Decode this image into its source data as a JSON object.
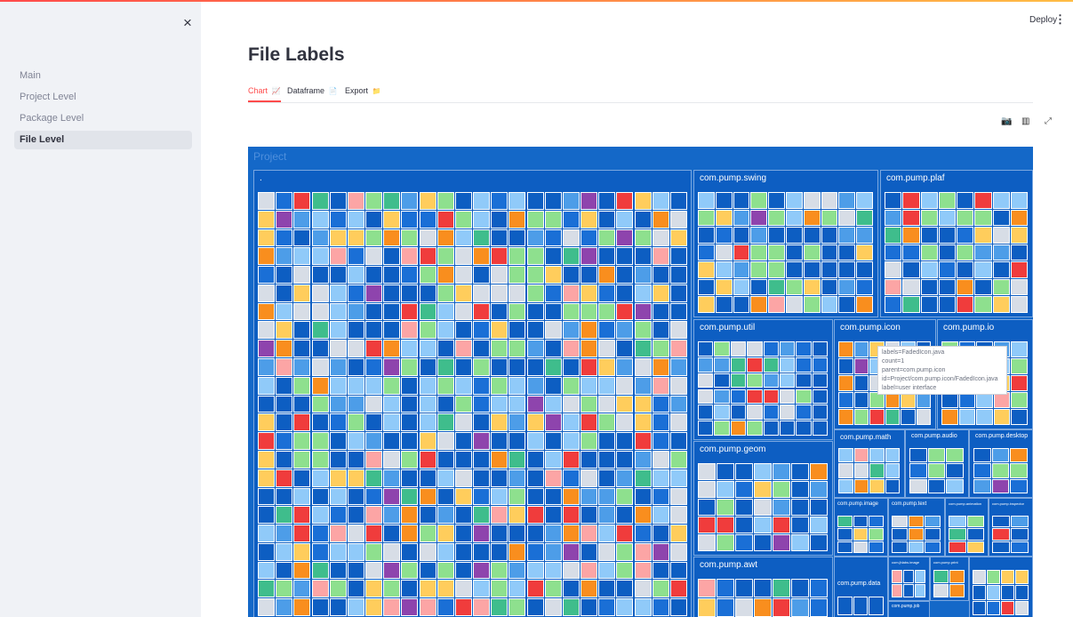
{
  "sidebar": {
    "close_label": "×",
    "items": [
      {
        "label": "Main",
        "active": false
      },
      {
        "label": "Project Level",
        "active": false
      },
      {
        "label": "Package Level",
        "active": false
      },
      {
        "label": "File Level",
        "active": true
      }
    ]
  },
  "header": {
    "deploy_label": "Deploy",
    "menu_label": "⋮"
  },
  "page": {
    "title": "File Labels"
  },
  "tabs": [
    {
      "label": "Chart",
      "icon": "chart-icon",
      "glyph": "📈",
      "active": true
    },
    {
      "label": "Dataframe",
      "icon": "document-icon",
      "glyph": "📄",
      "active": false
    },
    {
      "label": "Export",
      "icon": "folder-icon",
      "glyph": "📁",
      "active": false
    }
  ],
  "toolbar": {
    "camera_glyph": "📷",
    "plotly_glyph": "▥",
    "expand_glyph": "⤢"
  },
  "colors": {
    "accent": "#ff4b4b",
    "treemap_bg": "#1468c8",
    "palette": [
      "#0d5ec2",
      "#1a6fd6",
      "#90caf9",
      "#4d9de8",
      "#d7dde6",
      "#8ee08e",
      "#3fbd8c",
      "#ffcd5c",
      "#f98e1e",
      "#fca5a5",
      "#f03c3c",
      "#8e44ad"
    ]
  },
  "chart_data": {
    "type": "treemap",
    "root": "Project",
    "packages": [
      {
        "name": "."
      },
      {
        "name": "com.pump.swing"
      },
      {
        "name": "com.pump.plaf"
      },
      {
        "name": "com.pump.util"
      },
      {
        "name": "com.pump.icon"
      },
      {
        "name": "com.pump.io"
      },
      {
        "name": "com.pump.geom"
      },
      {
        "name": "com.pump.math"
      },
      {
        "name": "com.pump.audio"
      },
      {
        "name": "com.pump.desktop"
      },
      {
        "name": "com.pump.awt"
      },
      {
        "name": "com.pump.image"
      },
      {
        "name": "com.pump.text"
      },
      {
        "name": "com.pump.animation"
      },
      {
        "name": "com.pump.inspector"
      },
      {
        "name": "com.pump.data"
      },
      {
        "name": "com.jhlabs.image"
      },
      {
        "name": "com.pump.print"
      },
      {
        "name": "com.pump.job"
      }
    ],
    "hover": {
      "labels": "labels=FadedIcon.java",
      "count": "count=1",
      "parent": "parent=com.pump.icon",
      "id": "id=Project/com.pump.icon/FadedIcon.java",
      "label": "label=user interface"
    }
  }
}
